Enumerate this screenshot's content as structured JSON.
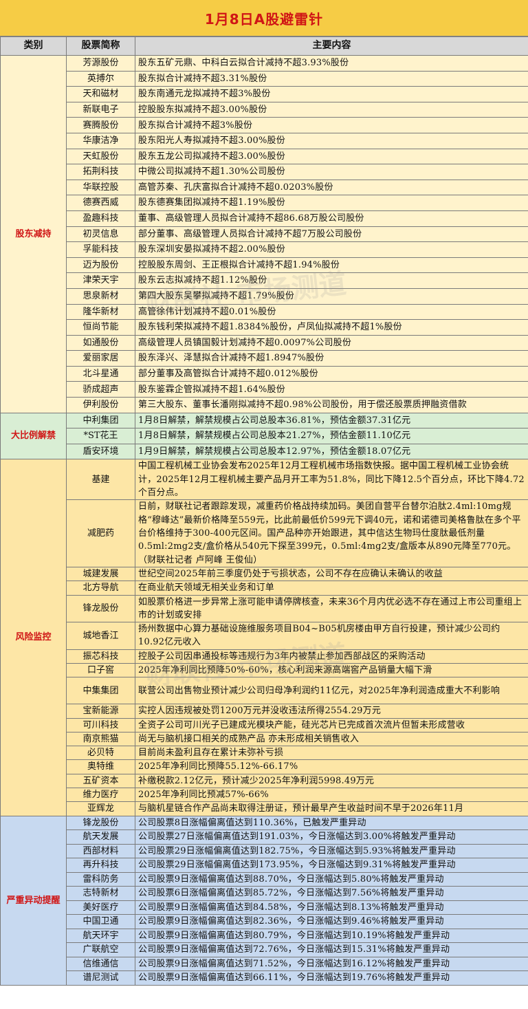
{
  "title": "1月8日A股避雷针",
  "watermark": "财联社 市场测道",
  "headers": {
    "category": "类别",
    "stock": "股票简称",
    "content": "主要内容"
  },
  "colors": {
    "title_bg": "#f6cc45",
    "title_text": "#d01616",
    "category_text": "#d01616",
    "section1_bg": "#fff3cc",
    "section2_bg": "#d9eed4",
    "section3_bg": "#fde6a6",
    "section4_bg": "#c7d9f0"
  },
  "sections": [
    {
      "category": "股东减持",
      "rows": [
        {
          "stock": "芳源股份",
          "content": "股东五矿元鼎、中科白云拟合计减持不超3.93%股份"
        },
        {
          "stock": "英搏尔",
          "content": "股东拟合计减持不超3.31%股份"
        },
        {
          "stock": "天和磁材",
          "content": "股东南通元龙拟减持不超3%股份"
        },
        {
          "stock": "新联电子",
          "content": "控股股东拟减持不超3.00%股份"
        },
        {
          "stock": "赛腾股份",
          "content": "股东拟合计减持不超3%股份"
        },
        {
          "stock": "华康洁净",
          "content": "股东阳光人寿拟减持不超3.00%股份"
        },
        {
          "stock": "天虹股份",
          "content": "股东五龙公司拟减持不超3.00%股份"
        },
        {
          "stock": "拓荆科技",
          "content": "中微公司拟减持不超1.30%公司股份"
        },
        {
          "stock": "华联控股",
          "content": "高管苏秦、孔庆富拟合计减持不超0.0203%股份"
        },
        {
          "stock": "德赛西威",
          "content": "股东德赛集团拟减持不超1.19%股份"
        },
        {
          "stock": "盈趣科技",
          "content": "董事、高级管理人员拟合计减持不超86.68万股公司股份"
        },
        {
          "stock": "初灵信息",
          "content": "部分董事、高级管理人员拟合计减持不超7万股公司股份"
        },
        {
          "stock": "孚能科技",
          "content": "股东深圳安晏拟减持不超2.00%股份"
        },
        {
          "stock": "迈为股份",
          "content": "控股股东周剑、王正根拟合计减持不超1.94%股份"
        },
        {
          "stock": "津荣天宇",
          "content": "股东云志拟减持不超1.12%股份"
        },
        {
          "stock": "思泉新材",
          "content": "第四大股东吴攀拟减持不超1.79%股份"
        },
        {
          "stock": "隆华新材",
          "content": "高管徐伟计划减持不超0.01%股份"
        },
        {
          "stock": "恒尚节能",
          "content": "股东钱利荣拟减持不超1.8384%股份，卢凤仙拟减持不超1%股份"
        },
        {
          "stock": "如通股份",
          "content": "高级管理人员镇国毅计划减持不超0.0097%公司股份"
        },
        {
          "stock": "爱丽家居",
          "content": "股东泽兴、泽慧拟合计减持不超1.8947%股份"
        },
        {
          "stock": "北斗星通",
          "content": "部分董事及高管拟合计减持不超0.012%股份"
        },
        {
          "stock": "骄成超声",
          "content": "股东鉴霖企管拟减持不超1.64%股份"
        },
        {
          "stock": "伊利股份",
          "content": "第三大股东、董事长潘刚拟减持不超0.98%公司股份，用于偿还股票质押融资借款"
        }
      ]
    },
    {
      "category": "大比例解禁",
      "rows": [
        {
          "stock": "中利集团",
          "content": "1月8日解禁，解禁规模占公司总股本36.81%，预估金额37.31亿元"
        },
        {
          "stock": "*ST花王",
          "content": "1月8日解禁，解禁规模占公司总股本21.27%，预估金额11.10亿元"
        },
        {
          "stock": "盾安环境",
          "content": "1月9日解禁，解禁规模占公司总股本12.97%，预估金额18.07亿元"
        }
      ]
    },
    {
      "category": "风险监控",
      "rows": [
        {
          "stock": "基建",
          "content": "中国工程机械工业协会发布2025年12月工程机械市场指数快报。据中国工程机械工业协会统计，2025年12月工程机械主要产品月开工率为51.8%，同比下降12.5个百分点，环比下降4.72个百分点。"
        },
        {
          "stock": "减肥药",
          "content": "日前，财联社记者跟踪发现，减重药价格战持续加码。美团自营平台替尔泊肽2.4ml:10mg规格“穆峰达”最新价格降至559元，比此前最低价599元下调40元，诺和诺德司美格鲁肽在多个平台价格维持于300-400元区间。国产品种亦开始跟进，其中信达生物玛仕度肽最低剂量0.5ml:2mg2支/盒价格从540元下探至399元，0.5ml:4mg2支/盒版本从890元降至770元。（财联社记者 卢阿峰 王俊仙）"
        },
        {
          "stock": "城建发展",
          "content": "世纪空间2025年前三季度仍处于亏损状态，公司不存在应确认未确认的收益"
        },
        {
          "stock": "北方导航",
          "content": "在商业航天领域无相关业务和订单"
        },
        {
          "stock": "锋龙股份",
          "content": "如股票价格进一步异常上涨可能申请停牌核查，未来36个月内优必选不存在通过上市公司重组上市的计划或安排"
        },
        {
          "stock": "城地香江",
          "content": "扬州数据中心算力基础设施维服务项目B04~B05机房楼由甲方自行投建，预计减少公司约10.92亿元收入"
        },
        {
          "stock": "振芯科技",
          "content": "控股子公司因串通投标等违规行为3年内被禁止参加西部战区的采购活动"
        },
        {
          "stock": "口子窖",
          "content": "2025年净利同比预降50%-60%，核心利润来源高端窖产品销量大幅下滑"
        },
        {
          "stock": "中集集团",
          "content": "联营公司出售物业预计减少公司归母净利润约11亿元，对2025年净利润造成重大不利影响"
        },
        {
          "stock": "宝新能源",
          "content": "实控人因违规被处罚1200万元并没收违法所得2554.29万元"
        },
        {
          "stock": "可川科技",
          "content": "全资子公司可川光子已建成光模块产能，硅光芯片已完成首次流片但暂未形成营收"
        },
        {
          "stock": "南京熊猫",
          "content": "尚无与脑机接口相关的成熟产品 亦未形成相关销售收入"
        },
        {
          "stock": "必贝特",
          "content": "目前尚未盈利且存在累计未弥补亏损"
        },
        {
          "stock": "奥特维",
          "content": "2025年净利同比预降55.12%-66.17%"
        },
        {
          "stock": "五矿资本",
          "content": "补缴税款2.12亿元，预计减少2025年净利润5998.49万元"
        },
        {
          "stock": "维力医疗",
          "content": "2025年净利同比预减57%-66%"
        },
        {
          "stock": "亚辉龙",
          "content": "与脑机星链合作产品尚未取得注册证，预计最早产生收益时间不早于2026年11月"
        }
      ]
    },
    {
      "category": "严重异动提醒",
      "rows": [
        {
          "stock": "锋龙股份",
          "content": "公司股票8日涨幅偏离值达到110.36%，已触发严重异动"
        },
        {
          "stock": "航天发展",
          "content": "公司股票27日涨幅偏离值达到191.03%，今日涨幅达到3.00%将触发严重异动"
        },
        {
          "stock": "西部材料",
          "content": "公司股票29日涨幅偏离值达到182.75%，今日涨幅达到5.93%将触发严重异动"
        },
        {
          "stock": "再升科技",
          "content": "公司股票29日涨幅偏离值达到173.95%，今日涨幅达到9.31%将触发严重异动"
        },
        {
          "stock": "雷科防务",
          "content": "公司股票9日涨幅偏离值达到88.70%，今日涨幅达到5.80%将触发严重异动"
        },
        {
          "stock": "志特新材",
          "content": "公司股票6日涨幅偏离值达到85.72%，今日涨幅达到7.56%将触发严重异动"
        },
        {
          "stock": "美好医疗",
          "content": "公司股票9日涨幅偏离值达到84.58%，今日涨幅达到8.13%将触发严重异动"
        },
        {
          "stock": "中国卫通",
          "content": "公司股票9日涨幅偏离值达到82.36%，今日涨幅达到9.46%将触发严重异动"
        },
        {
          "stock": "航天环宇",
          "content": "公司股票9日涨幅偏离值达到80.79%，今日涨幅达到10.19%将触发严重异动"
        },
        {
          "stock": "广联航空",
          "content": "公司股票9日涨幅偏离值达到72.76%，今日涨幅达到15.31%将触发严重异动"
        },
        {
          "stock": "信维通信",
          "content": "公司股票9日涨幅偏离值达到71.52%，今日涨幅达到16.12%将触发严重异动"
        },
        {
          "stock": "谱尼测试",
          "content": "公司股票9日涨幅偏离值达到66.11%，今日涨幅达到19.76%将触发严重异动"
        }
      ]
    }
  ]
}
